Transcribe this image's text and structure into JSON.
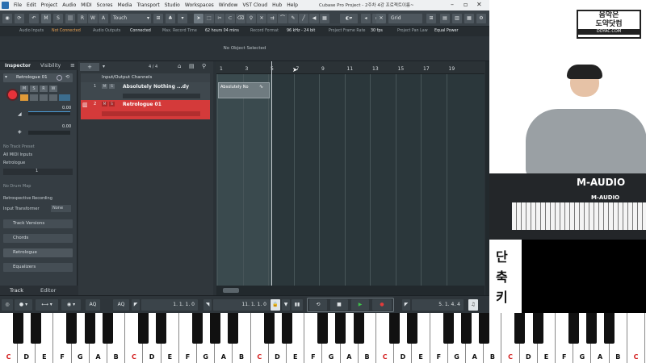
{
  "menu": {
    "items": [
      "File",
      "Edit",
      "Project",
      "Audio",
      "MIDI",
      "Scores",
      "Media",
      "Transport",
      "Studio",
      "Workspaces",
      "Window",
      "VST Cloud",
      "Hub",
      "Help"
    ],
    "window_title": "Cubase Pro Project - 2주차 4강 프로젝트이름~"
  },
  "toolbar": {
    "m": "M",
    "s": "S",
    "r": "R",
    "w": "W",
    "a": "A",
    "mode": "Touch",
    "grid_label": "Grid"
  },
  "status": {
    "audio_inputs": "Audio Inputs",
    "not_connected": "Not Connected",
    "audio_outputs": "Audio Outputs",
    "connected": "Connected",
    "max_rec_label": "Max. Record Time",
    "max_rec_val": "62 hours 04 mins",
    "rec_format_label": "Record Format",
    "rec_format_val": "96 kHz - 24 bit",
    "frame_rate_label": "Project Frame Rate",
    "frame_rate_val": "30 fps",
    "pan_law_label": "Project Pan Law",
    "pan_law_val": "Equal Power"
  },
  "info": {
    "no_object": "No Object Selected"
  },
  "inspector": {
    "tab_inspector": "Inspector",
    "tab_visibility": "Visibility",
    "track_name": "Retrologue 01",
    "m": "M",
    "s": "S",
    "r": "R",
    "w": "W",
    "a": "A",
    "vol": "0.00",
    "pan": "0.00",
    "no_preset": "No Track Preset",
    "midi_inputs": "All MIDI Inputs",
    "output": "Retrologue",
    "ch": "1",
    "no_drum": "No Drum Map",
    "retro_rec": "Retrospective Recording",
    "input_transformer": "Input Transformer",
    "none": "None",
    "track_versions": "Track Versions",
    "chords": "Chords",
    "retrologue": "Retrologue",
    "equalizers": "Equalizers",
    "tab_track": "Track",
    "tab_editor": "Editor"
  },
  "tracklist": {
    "folder": "Input/Output Channels",
    "count": "4 / 4",
    "track1_num": "1",
    "track1": "Absolutely Nothing ...dy",
    "track2_num": "2",
    "track2": "Retrologue 01",
    "m": "M",
    "s": "S"
  },
  "ruler": {
    "ticks": [
      "1",
      "3",
      "5",
      "7",
      "9",
      "11",
      "13",
      "15",
      "17",
      "19"
    ]
  },
  "clip": {
    "name": "Absolutely No"
  },
  "transport": {
    "aq1": "AQ",
    "aq2": "AQ",
    "left_loc": "1. 1. 1.   0",
    "right_loc": "11. 1. 1.   0",
    "pos": "5. 1. 4.   4"
  },
  "video": {
    "logo_top": "음악은",
    "logo_mid": "도약닷컴",
    "logo_url": "DOYAC.COM",
    "side_label_1": "단",
    "side_label_2": "축",
    "side_label_3": "키",
    "brand": "M-AUDIO",
    "brand2": "M-AUDIO"
  },
  "piano": {
    "labels": [
      "C",
      "D",
      "E",
      "F",
      "G",
      "A",
      "B",
      "C",
      "D",
      "E",
      "F",
      "G",
      "A",
      "B",
      "C",
      "D",
      "E",
      "F",
      "G",
      "A",
      "B",
      "C",
      "D",
      "E",
      "F",
      "G",
      "A",
      "B",
      "C",
      "D",
      "E",
      "F",
      "G",
      "A",
      "B",
      "C"
    ]
  },
  "colors": {
    "selected_track": "#d43a3a",
    "play": "#3fc24a",
    "record": "#e23b3b",
    "accent_red": "#e8323a"
  }
}
